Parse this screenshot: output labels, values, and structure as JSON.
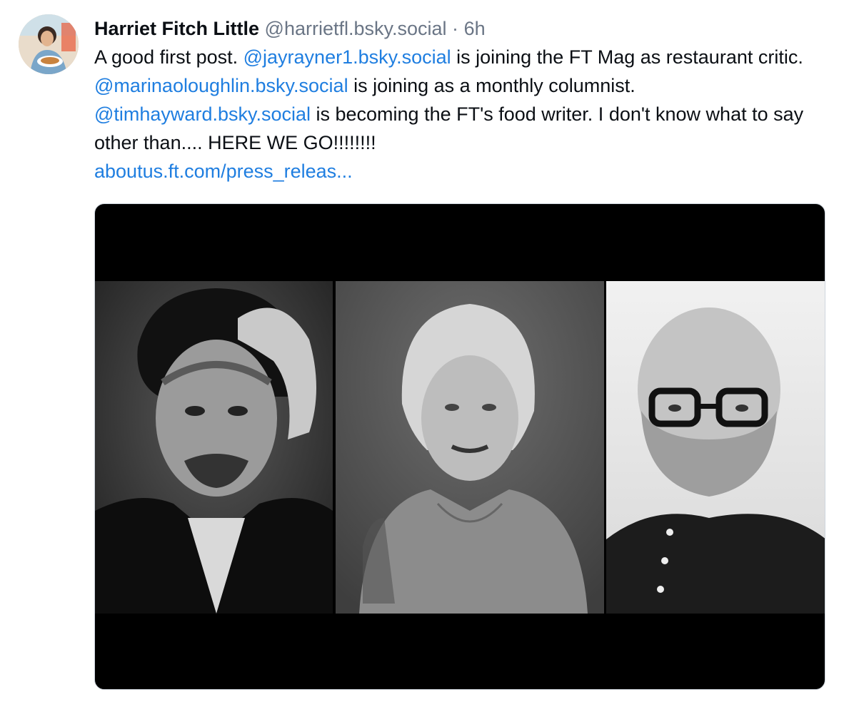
{
  "post": {
    "author_name": "Harriet Fitch Little",
    "handle": "@harrietfl.bsky.social",
    "separator": "·",
    "timestamp": "6h",
    "text": {
      "part1": "A good first post. ",
      "mention1": "@jayrayner1.bsky.social",
      "part2": " is joining the FT Mag as restaurant critic. ",
      "mention2": "@marinaoloughlin.bsky.social",
      "part3": " is joining as a monthly columnist. ",
      "mention3": "@timhayward.bsky.social",
      "part4": " is becoming the FT's food writer. I don't know what to say other than.... HERE WE GO!!!!!!!!",
      "link": "aboutus.ft.com/press_releas..."
    }
  },
  "colors": {
    "link": "#1f7ee0",
    "text": "#0b0f14",
    "meta": "#6a7585"
  },
  "icons": {
    "avatar": "profile-photo",
    "media": "three-portraits-photo"
  }
}
